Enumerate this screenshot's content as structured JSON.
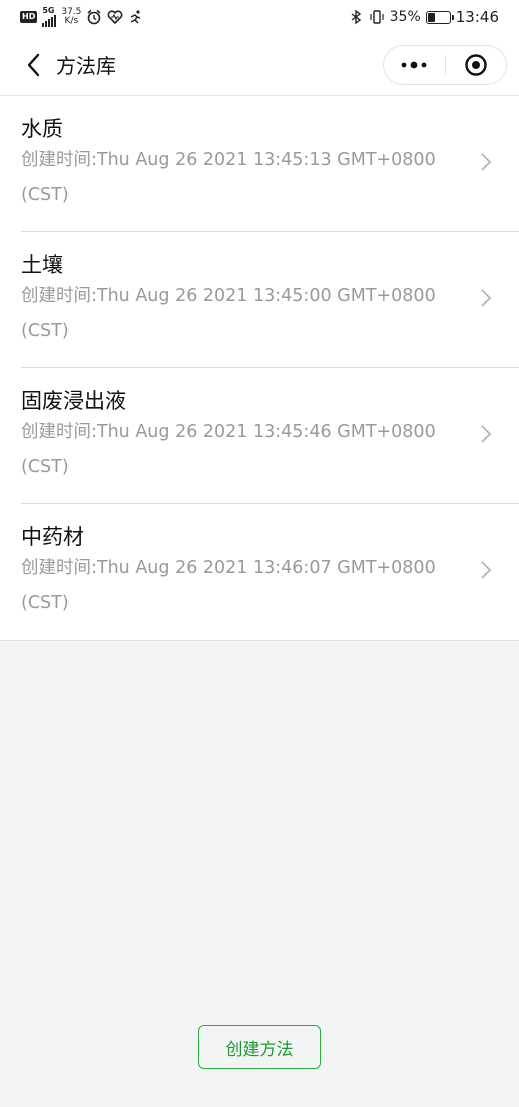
{
  "status_bar": {
    "hd": "HD",
    "network": "5G",
    "speed_value": "37.5",
    "speed_unit": "K/s",
    "battery_percent": "35%",
    "battery_level": 0.35,
    "time": "13:46"
  },
  "nav": {
    "title": "方法库"
  },
  "methods": [
    {
      "name": "水质",
      "created": "创建时间:Thu Aug 26 2021 13:45:13 GMT+0800 (CST)"
    },
    {
      "name": "土壤",
      "created": "创建时间:Thu Aug 26 2021 13:45:00 GMT+0800 (CST)"
    },
    {
      "name": "固废浸出液",
      "created": "创建时间:Thu Aug 26 2021 13:45:46 GMT+0800 (CST)"
    },
    {
      "name": "中药材",
      "created": "创建时间:Thu Aug 26 2021 13:46:07 GMT+0800 (CST)"
    }
  ],
  "actions": {
    "create_label": "创建方法"
  },
  "colors": {
    "accent": "#1e9b2d",
    "background": "#f3f4f6"
  }
}
